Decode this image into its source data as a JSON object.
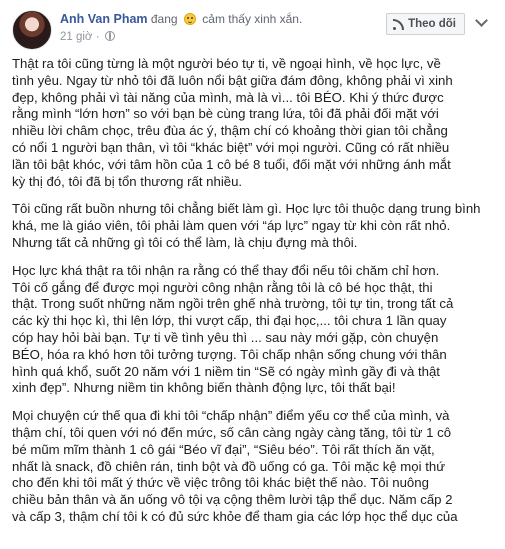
{
  "post": {
    "author": "Anh Van Pham",
    "feeling_prefix": "đang",
    "feeling_icon": "smiling-face-icon",
    "feeling_text": "cảm thấy xinh xắn.",
    "time": "21 giờ",
    "time_separator": "·",
    "privacy_icon": "globe-icon",
    "follow_label": "Theo dõi",
    "paragraphs": [
      "Thật ra tôi cũng từng là một người béo tự ti, về ngoại hình, về học lực, về\ntình yêu. Ngay từ nhỏ tôi đã luôn nổi bật giữa đám đông, không phải vì xinh\nđẹp, không phải vì tài năng của mình, mà là vì... tôi BÉO. Khi ý thức được\nrằng mình “lớn hơn” so với bạn bè cùng trang lứa, tôi đã phải đối mặt với\nnhiều lời châm chọc, trêu đùa ác ý, thậm chí có khoảng thời gian tôi chẳng\ncó nổi 1 người bạn thân, vì tôi “khác biệt” với mọi người. Cũng có rất nhiều\nlần tôi bật khóc, với tâm hồn của 1 cô bé 8 tuổi, đối mặt với những ánh mắt\nkỳ thị đó, tôi đã bị tổn thương rất nhiều.",
      "Tôi cũng rất buồn nhưng tôi chẳng biết làm gì. Học lực tôi thuộc dạng trung bình\nkhá, me là giáo viên, tôi phải làm quen với “áp lực” ngay từ khi còn rất nhỏ.\nNhưng tất cả những gì tôi có thể làm, là chịu đựng mà thôi.",
      "Học lực khá thật ra tôi nhận ra rằng có thể thay đổi nếu tôi chăm chỉ hơn.\nTôi cố gắng để được mọi người công nhận rằng tôi là cô bé học thật, thi\nthật. Trong suốt những năm ngồi trên ghế nhà trường, tôi tự tin, trong tất cả\ncác kỳ thi học kì, thi lên lớp, thi vượt cấp, thi đại học,... tôi chưa 1 lần quay\ncóp hay hỏi bài bạn. Tự ti về tình yêu thì ... sau này mới gặp, còn chuyện\nBÉO, hóa ra khó hơn tôi tưởng tượng. Tôi chấp nhận sống chung với thân\nhình quá khổ, suốt 20 năm với 1 niềm tin “Sẽ có ngày mình gầy đi và thật\nxinh đẹp”. Nhưng niềm tin không biến thành động lực, tôi thất bại!",
      "Mọi chuyện cứ thế qua đi khi tôi “chấp nhận” điểm yếu cơ thể của mình, và\nthậm chí, tôi quen với nó đến mức, số cân càng ngày càng tăng, tôi từ 1 cô\nbé mũm mĩm thành 1 cô gái “Béo vĩ đại”, “Siêu béo”. Tôi rất thích ăn vặt,\nnhất là snack, đồ chiên rán, tinh bột và đồ uống có ga. Tôi mặc kệ mọi thứ\ncho đến khi tôi mất ý thức về việc trông tôi khác biệt thế nào. Tôi nuông\nchiều bản thân và ăn uống vô tội vạ cộng thêm lười tập thể dục. Năm cấp 2\nvà cấp 3, thậm chí tôi k có đủ sức khỏe để tham gia các lớp học thể dục của"
    ]
  }
}
